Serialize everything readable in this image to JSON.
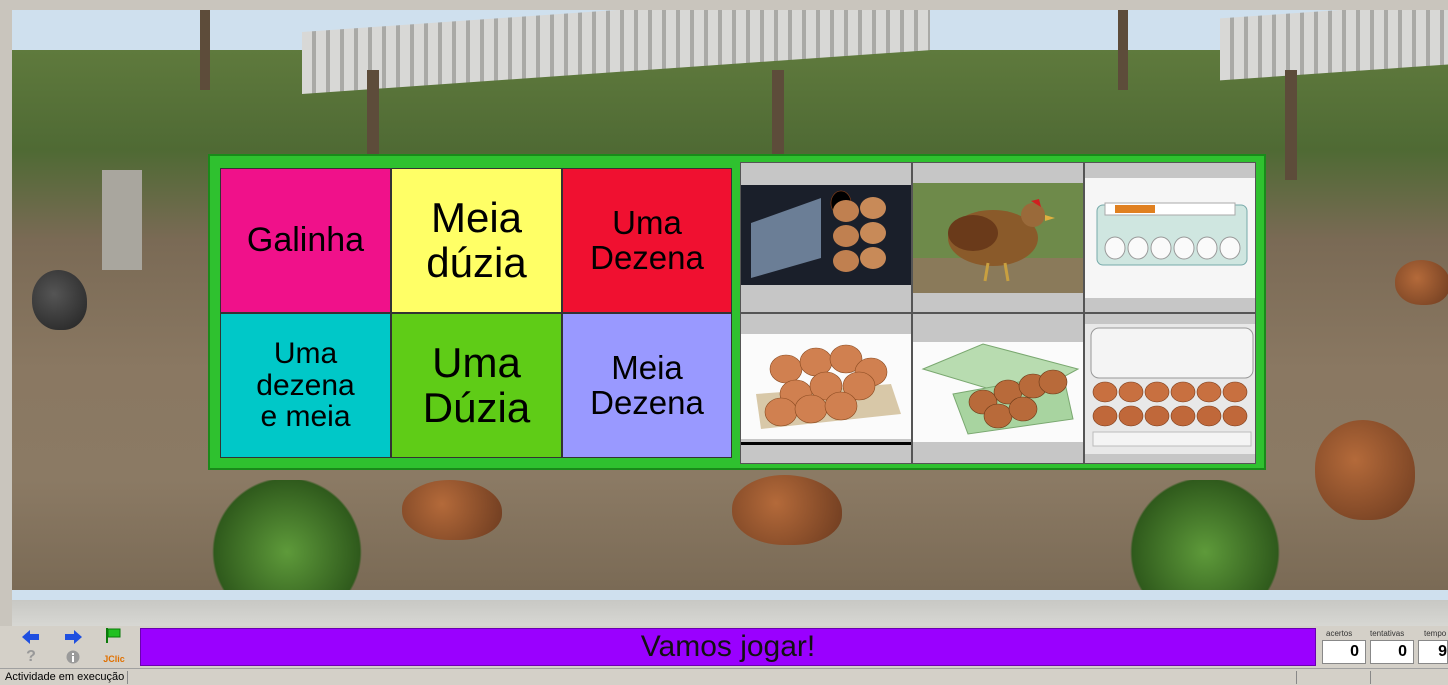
{
  "board": {
    "text_cells": [
      {
        "lines": [
          "Galinha"
        ],
        "color": "#f0118a",
        "font_size": 34
      },
      {
        "lines": [
          "Meia",
          "dúzia"
        ],
        "color": "#ffff66",
        "font_size": 42
      },
      {
        "lines": [
          "Uma",
          "Dezena"
        ],
        "color": "#f01030",
        "font_size": 33
      },
      {
        "lines": [
          "Uma",
          "dezena",
          "e meia"
        ],
        "color": "#00c8c8",
        "font_size": 30
      },
      {
        "lines": [
          "Uma",
          "Dúzia"
        ],
        "color": "#5fcc17",
        "font_size": 42
      },
      {
        "lines": [
          "Meia",
          "Dezena"
        ],
        "color": "#9999ff",
        "font_size": 33
      }
    ],
    "image_cells": [
      "half-dozen-eggs-tray-icon",
      "hen-photo-icon",
      "dozen-eggs-carton-icon",
      "ten-eggs-tray-icon",
      "eggs-green-carton-icon",
      "dozen-eggs-open-carton-icon"
    ],
    "border_color": "#2fc12f"
  },
  "controls": {
    "prev_icon": "arrow-left-icon",
    "next_icon": "arrow-right-icon",
    "restart_icon": "flag-icon",
    "help_icon": "question-icon",
    "info_icon": "info-icon",
    "jclic_label": "JClic",
    "message": "Vamos jogar!",
    "message_color": "#9a00ff"
  },
  "counters": {
    "acertos_label": "acertos",
    "acertos_value": "0",
    "tentativas_label": "tentativas",
    "tentativas_value": "0",
    "tempo_label": "tempo",
    "tempo_value": "9"
  },
  "status": {
    "text": "Actividade em execução"
  }
}
